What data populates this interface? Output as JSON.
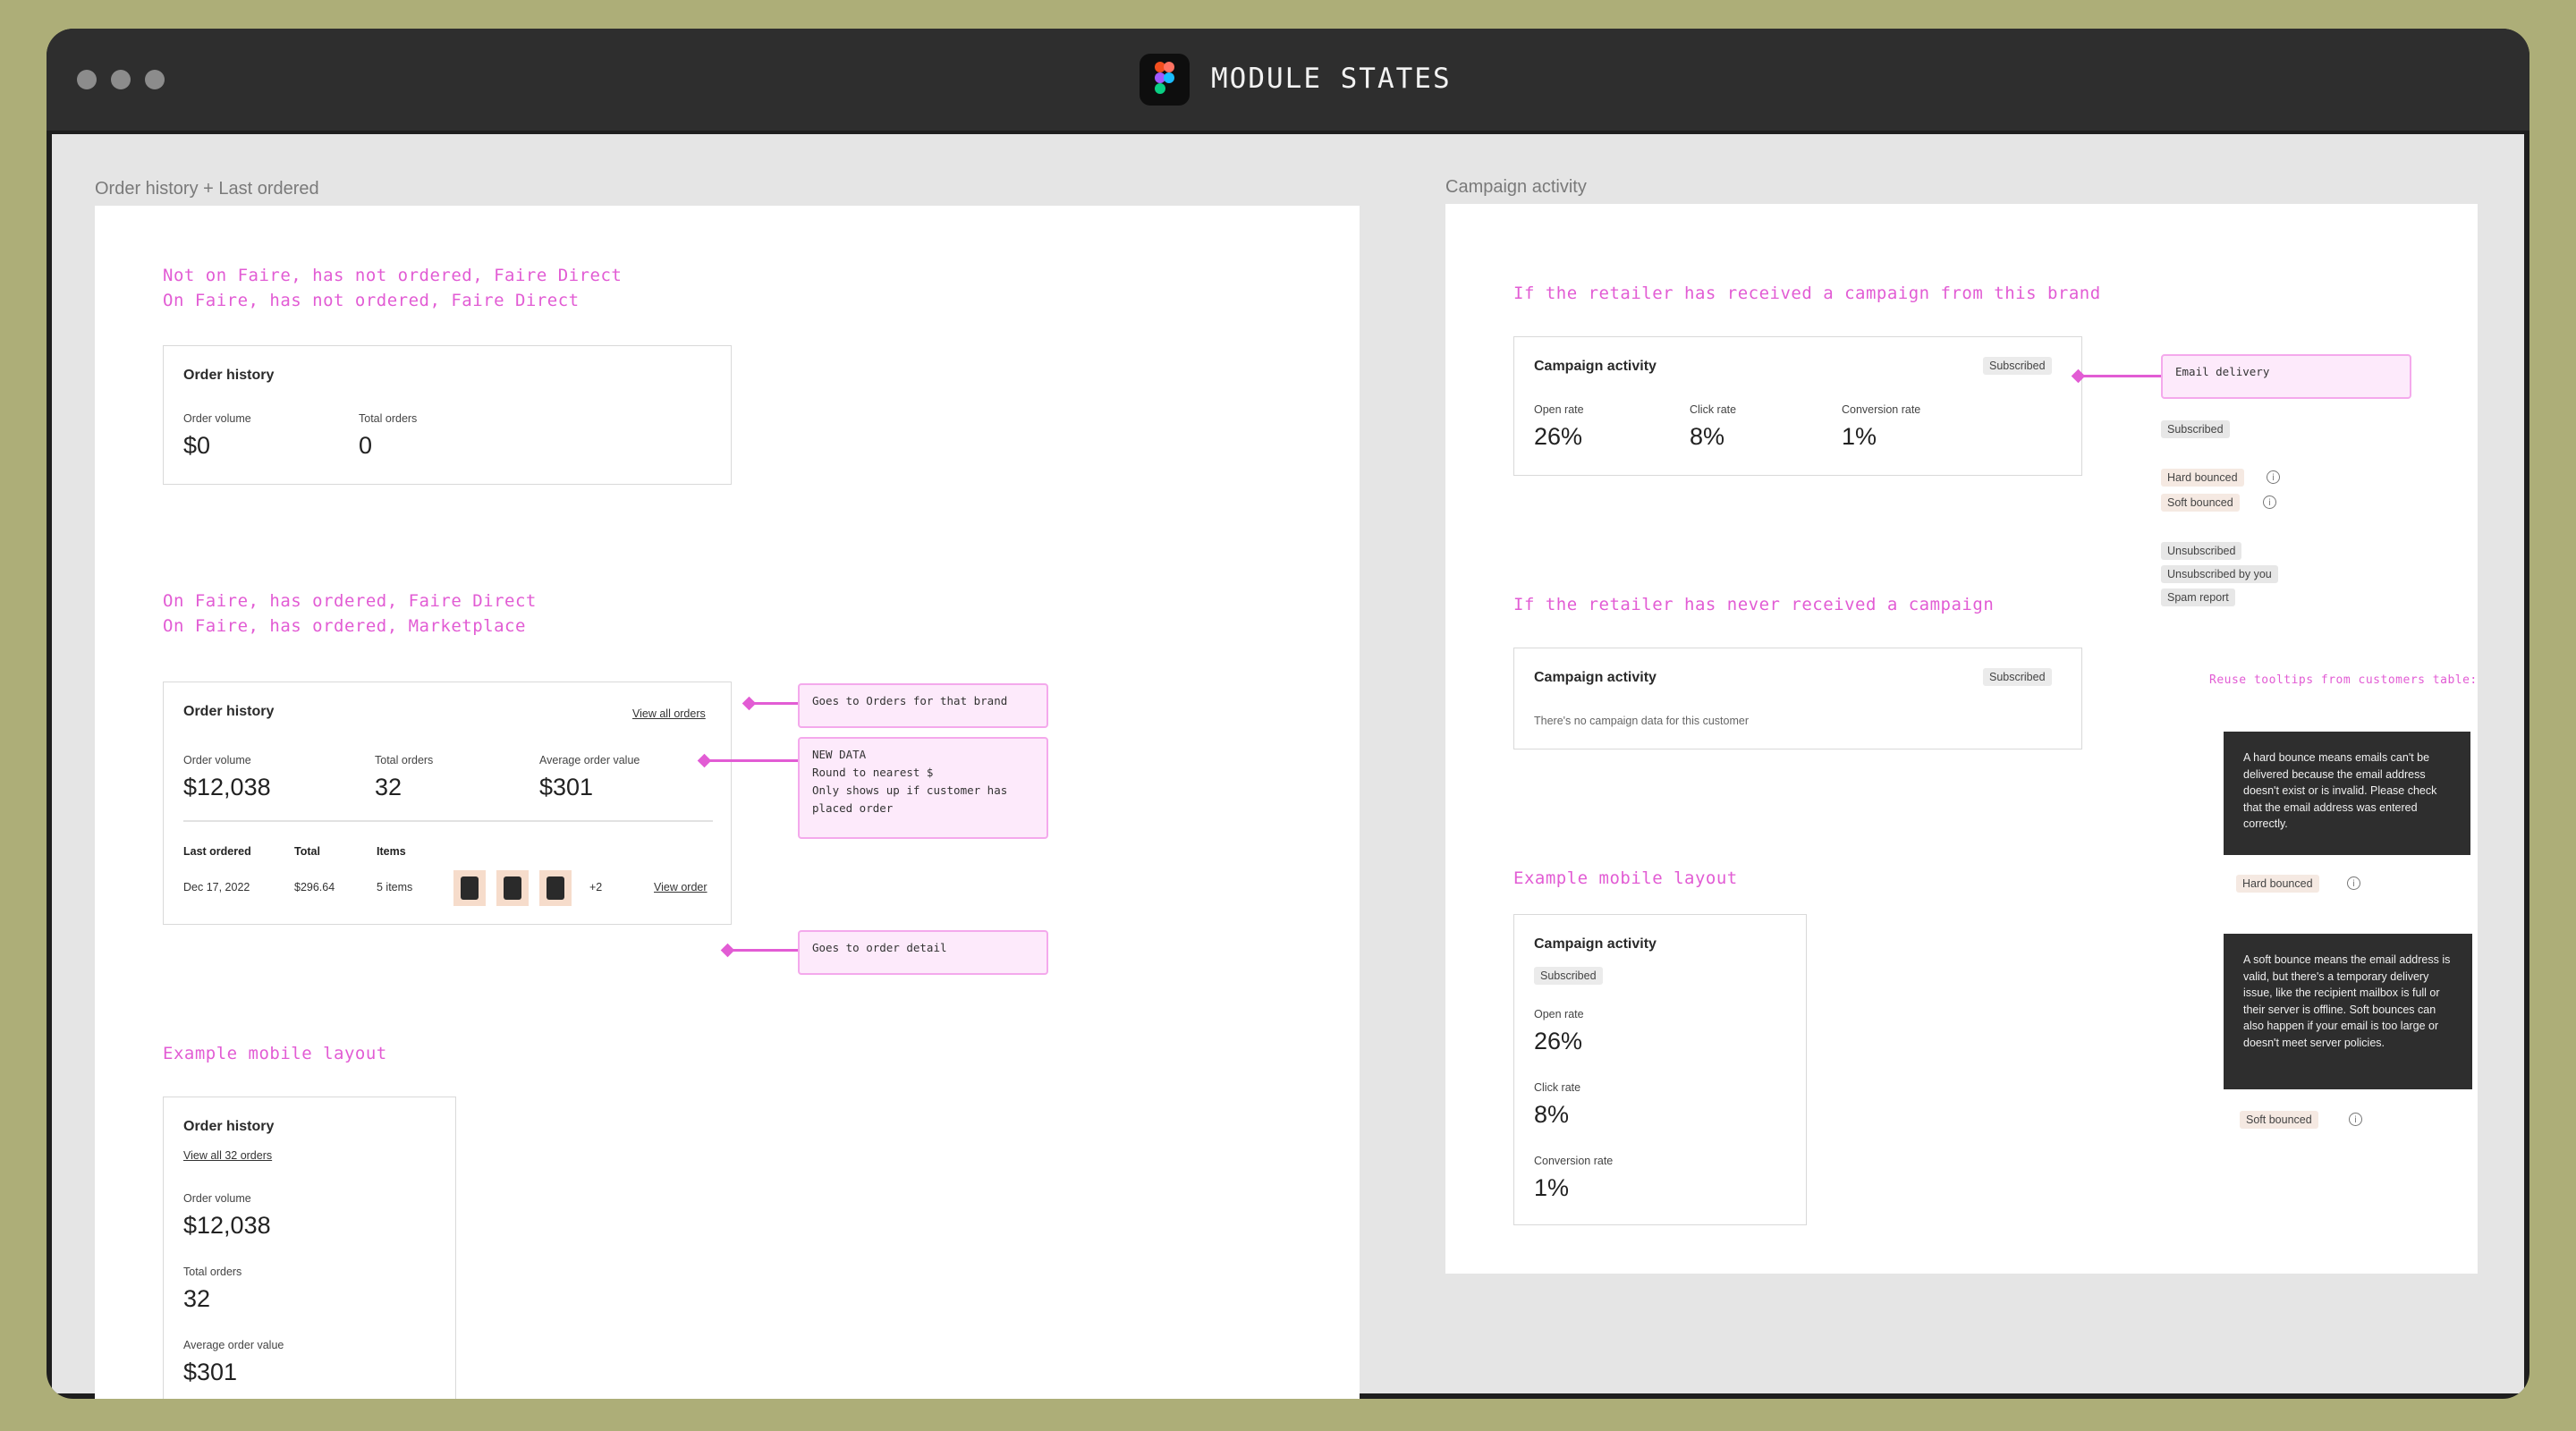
{
  "window": {
    "title": "MODULE STATES"
  },
  "left_section": {
    "label": "Order history + Last ordered",
    "state1_note": "Not on Faire, has not ordered, Faire Direct\nOn Faire, has not ordered, Faire Direct",
    "card1": {
      "title": "Order history",
      "order_volume_label": "Order volume",
      "order_volume_value": "$0",
      "total_orders_label": "Total orders",
      "total_orders_value": "0"
    },
    "state2_note": "On Faire, has ordered, Faire Direct\nOn Faire, has ordered, Marketplace",
    "card2": {
      "title": "Order history",
      "view_all_link": "View all orders",
      "order_volume_label": "Order volume",
      "order_volume_value": "$12,038",
      "total_orders_label": "Total orders",
      "total_orders_value": "32",
      "aov_label": "Average order value",
      "aov_value": "$301",
      "last_ordered_header": "Last ordered",
      "total_header": "Total",
      "items_header": "Items",
      "last_ordered_value": "Dec 17, 2022",
      "total_value": "$296.64",
      "items_value": "5 items",
      "more_count": "+2",
      "view_order_link": "View order"
    },
    "annotations": {
      "orders_link": "Goes to Orders for that brand",
      "new_data": "NEW DATA\nRound to nearest $\nOnly shows up if customer has\nplaced order",
      "order_detail": "Goes to order detail"
    },
    "mobile_note": "Example mobile layout",
    "mobile_card": {
      "title": "Order history",
      "view_all_link": "View all 32 orders",
      "order_volume_label": "Order volume",
      "order_volume_value": "$12,038",
      "total_orders_label": "Total orders",
      "total_orders_value": "32",
      "aov_label": "Average order value",
      "aov_value": "$301"
    }
  },
  "right_section": {
    "label": "Campaign activity",
    "state1_note": "If the retailer has received a campaign from this brand",
    "card1": {
      "title": "Campaign activity",
      "badge": "Subscribed",
      "open_rate_label": "Open rate",
      "open_rate_value": "26%",
      "click_rate_label": "Click rate",
      "click_rate_value": "8%",
      "conversion_rate_label": "Conversion rate",
      "conversion_rate_value": "1%"
    },
    "email_delivery_note": "Email delivery",
    "statuses": {
      "subscribed": "Subscribed",
      "hard_bounced": "Hard bounced",
      "soft_bounced": "Soft bounced",
      "unsubscribed": "Unsubscribed",
      "unsubscribed_by_you": "Unsubscribed by you",
      "spam_report": "Spam report"
    },
    "state2_note": "If the retailer has never received a campaign",
    "card2": {
      "title": "Campaign activity",
      "badge": "Subscribed",
      "empty_text": "There's no campaign data for this customer"
    },
    "tooltips_note": "Reuse tooltips from customers table:",
    "hard_bounce_tooltip": "A hard bounce means emails can't be delivered because the email address doesn't exist or is invalid. Please check that the email address was entered correctly.",
    "hard_bounce_tag": "Hard bounced",
    "soft_bounce_tooltip": "A soft bounce means the email address is valid, but there's a temporary delivery issue, like the recipient mailbox is full or their server is offline. Soft bounces can also happen if your email is too large or doesn't meet server policies.",
    "soft_bounce_tag": "Soft bounced",
    "mobile_note": "Example mobile layout",
    "mobile_card": {
      "title": "Campaign activity",
      "badge": "Subscribed",
      "open_rate_label": "Open rate",
      "open_rate_value": "26%",
      "click_rate_label": "Click rate",
      "click_rate_value": "8%",
      "conversion_rate_label": "Conversion rate",
      "conversion_rate_value": "1%"
    }
  },
  "icons": {
    "info": "info-icon",
    "figma": "figma-logo-icon"
  },
  "colors": {
    "accent": "#E25CD4",
    "background": "#ADAE78",
    "window": "#2E2E2E"
  }
}
